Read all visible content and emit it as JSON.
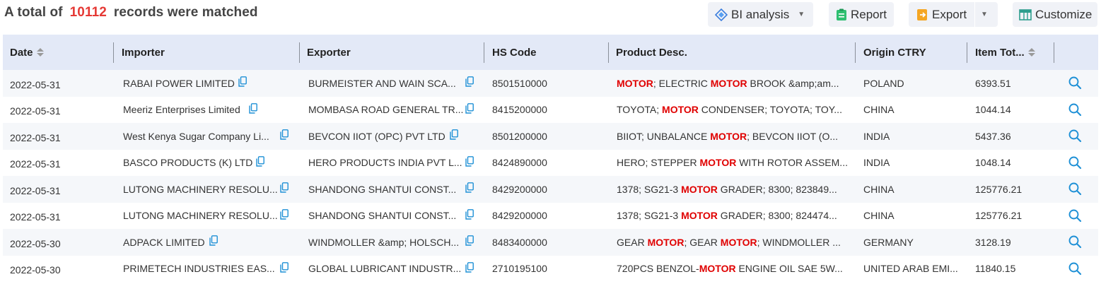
{
  "summary": {
    "prefix": "A total of",
    "count": "10112",
    "suffix": "records were matched"
  },
  "toolbar": {
    "bi_label": "BI analysis",
    "report_label": "Report",
    "export_label": "Export",
    "customize_label": "Customize"
  },
  "columns": {
    "date": "Date",
    "importer": "Importer",
    "exporter": "Exporter",
    "hs_code": "HS Code",
    "product": "Product Desc.",
    "origin": "Origin CTRY",
    "item_total": "Item Tot..."
  },
  "highlight_term": "MOTOR",
  "colors": {
    "accent": "#e53935",
    "highlight": "#e00000",
    "header_bg": "#e3e9f7",
    "alt_row_bg": "#f5f7fa",
    "icon_blue": "#1e90d6"
  },
  "rows": [
    {
      "date": "2022-05-31",
      "importer": "RABAI POWER LIMITED",
      "exporter": "BURMEISTER AND WAIN SCA...",
      "hs": "8501510000",
      "product": [
        {
          "t": "MOTOR",
          "h": true
        },
        {
          "t": "; ELECTRIC "
        },
        {
          "t": "MOTOR",
          "h": true
        },
        {
          "t": " BROOK &amp;am..."
        }
      ],
      "origin": "POLAND",
      "total": "6393.51"
    },
    {
      "date": "2022-05-31",
      "importer": "Meeriz Enterprises Limited",
      "exporter": "MOMBASA ROAD GENERAL TR...",
      "hs": "8415200000",
      "product": [
        {
          "t": "TOYOTA; "
        },
        {
          "t": "MOTOR",
          "h": true
        },
        {
          "t": " CONDENSER; TOYOTA; TOY..."
        }
      ],
      "origin": "CHINA",
      "total": "1044.14"
    },
    {
      "date": "2022-05-31",
      "importer": "West Kenya Sugar Company Li...",
      "exporter": "BEVCON IIOT (OPC) PVT LTD",
      "hs": "8501200000",
      "product": [
        {
          "t": "BIIOT; UNBALANCE "
        },
        {
          "t": "MOTOR",
          "h": true
        },
        {
          "t": "; BEVCON IIOT (O..."
        }
      ],
      "origin": "INDIA",
      "total": "5437.36"
    },
    {
      "date": "2022-05-31",
      "importer": "BASCO PRODUCTS (K) LTD",
      "exporter": "HERO PRODUCTS INDIA PVT L...",
      "hs": "8424890000",
      "product": [
        {
          "t": "HERO; STEPPER "
        },
        {
          "t": "MOTOR",
          "h": true
        },
        {
          "t": " WITH ROTOR ASSEM..."
        }
      ],
      "origin": "INDIA",
      "total": "1048.14"
    },
    {
      "date": "2022-05-31",
      "importer": "LUTONG MACHINERY RESOLU...",
      "exporter": "SHANDONG SHANTUI CONST...",
      "hs": "8429200000",
      "product": [
        {
          "t": "1378; SG21-3 "
        },
        {
          "t": "MOTOR",
          "h": true
        },
        {
          "t": " GRADER; 8300; 823849..."
        }
      ],
      "origin": "CHINA",
      "total": "125776.21"
    },
    {
      "date": "2022-05-31",
      "importer": "LUTONG MACHINERY RESOLU...",
      "exporter": "SHANDONG SHANTUI CONST...",
      "hs": "8429200000",
      "product": [
        {
          "t": "1378; SG21-3 "
        },
        {
          "t": "MOTOR",
          "h": true
        },
        {
          "t": " GRADER; 8300; 824474..."
        }
      ],
      "origin": "CHINA",
      "total": "125776.21"
    },
    {
      "date": "2022-05-30",
      "importer": "ADPACK LIMITED",
      "exporter": "WINDMOLLER &amp; HOLSCH...",
      "hs": "8483400000",
      "product": [
        {
          "t": "GEAR "
        },
        {
          "t": "MOTOR",
          "h": true
        },
        {
          "t": "; GEAR "
        },
        {
          "t": "MOTOR",
          "h": true
        },
        {
          "t": "; WINDMOLLER ..."
        }
      ],
      "origin": "GERMANY",
      "total": "3128.19"
    },
    {
      "date": "2022-05-30",
      "importer": "PRIMETECH INDUSTRIES EAS...",
      "exporter": "GLOBAL LUBRICANT INDUSTR...",
      "hs": "2710195100",
      "product": [
        {
          "t": "720PCS BENZOL-"
        },
        {
          "t": "MOTOR",
          "h": true
        },
        {
          "t": " ENGINE OIL SAE 5W..."
        }
      ],
      "origin": "UNITED ARAB EMI...",
      "total": "11840.15"
    }
  ]
}
